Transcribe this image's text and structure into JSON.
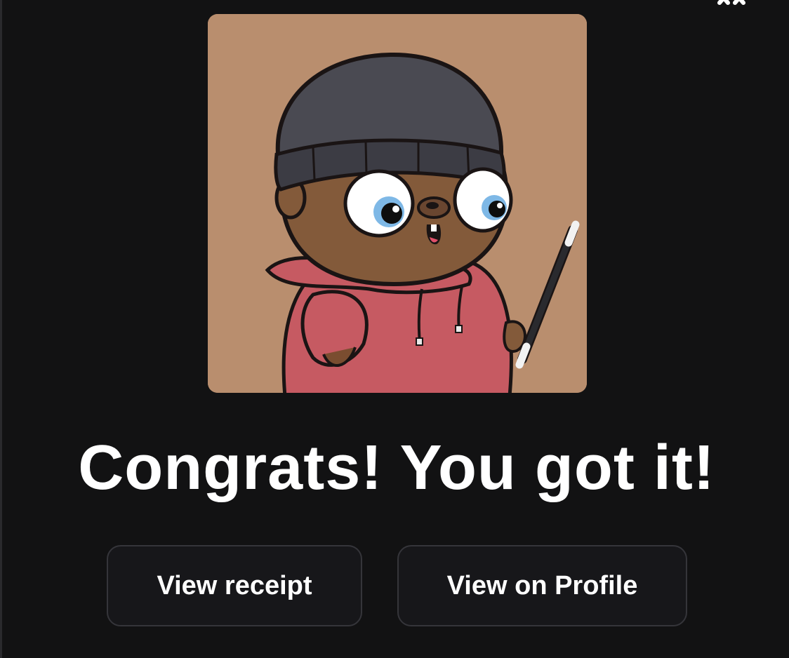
{
  "modal": {
    "close_icon": "close-icon",
    "nft_image": {
      "subject": "cartoon gopher wearing a dark beanie and pink hoodie holding a magic wand",
      "background_color": "#b98e6e"
    },
    "headline": "Congrats! You got it!",
    "buttons": {
      "view_receipt": "View receipt",
      "view_on_profile": "View on Profile"
    }
  },
  "colors": {
    "background": "#121213",
    "button_bg": "#17171a",
    "button_border": "#35353a",
    "text": "#ffffff"
  }
}
